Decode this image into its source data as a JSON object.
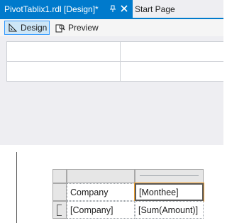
{
  "tabs": {
    "active_title": "PivotTablix1.rdl [Design]*",
    "inactive_title": "Start Page"
  },
  "view_tabs": {
    "design": "Design",
    "preview": "Preview"
  },
  "tablix": {
    "header_row": [
      "Company",
      "[Monthee]"
    ],
    "data_row": [
      "[Company]",
      "[Sum(Amount)]"
    ]
  },
  "colors": {
    "accent": "#007acc",
    "selected_border": "#f0a030"
  }
}
